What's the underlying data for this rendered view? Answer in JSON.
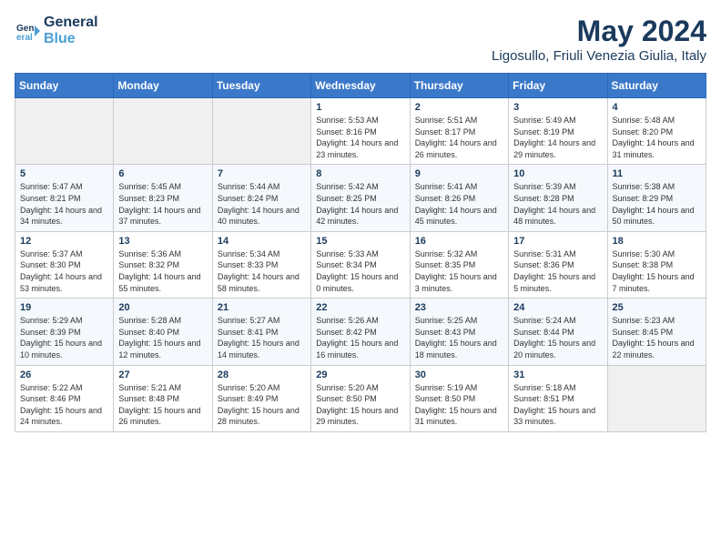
{
  "header": {
    "logo_line1": "General",
    "logo_line2": "Blue",
    "title": "May 2024",
    "subtitle": "Ligosullo, Friuli Venezia Giulia, Italy"
  },
  "weekdays": [
    "Sunday",
    "Monday",
    "Tuesday",
    "Wednesday",
    "Thursday",
    "Friday",
    "Saturday"
  ],
  "weeks": [
    [
      {
        "day": "",
        "sunrise": "",
        "sunset": "",
        "daylight": ""
      },
      {
        "day": "",
        "sunrise": "",
        "sunset": "",
        "daylight": ""
      },
      {
        "day": "",
        "sunrise": "",
        "sunset": "",
        "daylight": ""
      },
      {
        "day": "1",
        "sunrise": "Sunrise: 5:53 AM",
        "sunset": "Sunset: 8:16 PM",
        "daylight": "Daylight: 14 hours and 23 minutes."
      },
      {
        "day": "2",
        "sunrise": "Sunrise: 5:51 AM",
        "sunset": "Sunset: 8:17 PM",
        "daylight": "Daylight: 14 hours and 26 minutes."
      },
      {
        "day": "3",
        "sunrise": "Sunrise: 5:49 AM",
        "sunset": "Sunset: 8:19 PM",
        "daylight": "Daylight: 14 hours and 29 minutes."
      },
      {
        "day": "4",
        "sunrise": "Sunrise: 5:48 AM",
        "sunset": "Sunset: 8:20 PM",
        "daylight": "Daylight: 14 hours and 31 minutes."
      }
    ],
    [
      {
        "day": "5",
        "sunrise": "Sunrise: 5:47 AM",
        "sunset": "Sunset: 8:21 PM",
        "daylight": "Daylight: 14 hours and 34 minutes."
      },
      {
        "day": "6",
        "sunrise": "Sunrise: 5:45 AM",
        "sunset": "Sunset: 8:23 PM",
        "daylight": "Daylight: 14 hours and 37 minutes."
      },
      {
        "day": "7",
        "sunrise": "Sunrise: 5:44 AM",
        "sunset": "Sunset: 8:24 PM",
        "daylight": "Daylight: 14 hours and 40 minutes."
      },
      {
        "day": "8",
        "sunrise": "Sunrise: 5:42 AM",
        "sunset": "Sunset: 8:25 PM",
        "daylight": "Daylight: 14 hours and 42 minutes."
      },
      {
        "day": "9",
        "sunrise": "Sunrise: 5:41 AM",
        "sunset": "Sunset: 8:26 PM",
        "daylight": "Daylight: 14 hours and 45 minutes."
      },
      {
        "day": "10",
        "sunrise": "Sunrise: 5:39 AM",
        "sunset": "Sunset: 8:28 PM",
        "daylight": "Daylight: 14 hours and 48 minutes."
      },
      {
        "day": "11",
        "sunrise": "Sunrise: 5:38 AM",
        "sunset": "Sunset: 8:29 PM",
        "daylight": "Daylight: 14 hours and 50 minutes."
      }
    ],
    [
      {
        "day": "12",
        "sunrise": "Sunrise: 5:37 AM",
        "sunset": "Sunset: 8:30 PM",
        "daylight": "Daylight: 14 hours and 53 minutes."
      },
      {
        "day": "13",
        "sunrise": "Sunrise: 5:36 AM",
        "sunset": "Sunset: 8:32 PM",
        "daylight": "Daylight: 14 hours and 55 minutes."
      },
      {
        "day": "14",
        "sunrise": "Sunrise: 5:34 AM",
        "sunset": "Sunset: 8:33 PM",
        "daylight": "Daylight: 14 hours and 58 minutes."
      },
      {
        "day": "15",
        "sunrise": "Sunrise: 5:33 AM",
        "sunset": "Sunset: 8:34 PM",
        "daylight": "Daylight: 15 hours and 0 minutes."
      },
      {
        "day": "16",
        "sunrise": "Sunrise: 5:32 AM",
        "sunset": "Sunset: 8:35 PM",
        "daylight": "Daylight: 15 hours and 3 minutes."
      },
      {
        "day": "17",
        "sunrise": "Sunrise: 5:31 AM",
        "sunset": "Sunset: 8:36 PM",
        "daylight": "Daylight: 15 hours and 5 minutes."
      },
      {
        "day": "18",
        "sunrise": "Sunrise: 5:30 AM",
        "sunset": "Sunset: 8:38 PM",
        "daylight": "Daylight: 15 hours and 7 minutes."
      }
    ],
    [
      {
        "day": "19",
        "sunrise": "Sunrise: 5:29 AM",
        "sunset": "Sunset: 8:39 PM",
        "daylight": "Daylight: 15 hours and 10 minutes."
      },
      {
        "day": "20",
        "sunrise": "Sunrise: 5:28 AM",
        "sunset": "Sunset: 8:40 PM",
        "daylight": "Daylight: 15 hours and 12 minutes."
      },
      {
        "day": "21",
        "sunrise": "Sunrise: 5:27 AM",
        "sunset": "Sunset: 8:41 PM",
        "daylight": "Daylight: 15 hours and 14 minutes."
      },
      {
        "day": "22",
        "sunrise": "Sunrise: 5:26 AM",
        "sunset": "Sunset: 8:42 PM",
        "daylight": "Daylight: 15 hours and 16 minutes."
      },
      {
        "day": "23",
        "sunrise": "Sunrise: 5:25 AM",
        "sunset": "Sunset: 8:43 PM",
        "daylight": "Daylight: 15 hours and 18 minutes."
      },
      {
        "day": "24",
        "sunrise": "Sunrise: 5:24 AM",
        "sunset": "Sunset: 8:44 PM",
        "daylight": "Daylight: 15 hours and 20 minutes."
      },
      {
        "day": "25",
        "sunrise": "Sunrise: 5:23 AM",
        "sunset": "Sunset: 8:45 PM",
        "daylight": "Daylight: 15 hours and 22 minutes."
      }
    ],
    [
      {
        "day": "26",
        "sunrise": "Sunrise: 5:22 AM",
        "sunset": "Sunset: 8:46 PM",
        "daylight": "Daylight: 15 hours and 24 minutes."
      },
      {
        "day": "27",
        "sunrise": "Sunrise: 5:21 AM",
        "sunset": "Sunset: 8:48 PM",
        "daylight": "Daylight: 15 hours and 26 minutes."
      },
      {
        "day": "28",
        "sunrise": "Sunrise: 5:20 AM",
        "sunset": "Sunset: 8:49 PM",
        "daylight": "Daylight: 15 hours and 28 minutes."
      },
      {
        "day": "29",
        "sunrise": "Sunrise: 5:20 AM",
        "sunset": "Sunset: 8:50 PM",
        "daylight": "Daylight: 15 hours and 29 minutes."
      },
      {
        "day": "30",
        "sunrise": "Sunrise: 5:19 AM",
        "sunset": "Sunset: 8:50 PM",
        "daylight": "Daylight: 15 hours and 31 minutes."
      },
      {
        "day": "31",
        "sunrise": "Sunrise: 5:18 AM",
        "sunset": "Sunset: 8:51 PM",
        "daylight": "Daylight: 15 hours and 33 minutes."
      },
      {
        "day": "",
        "sunrise": "",
        "sunset": "",
        "daylight": ""
      }
    ]
  ]
}
